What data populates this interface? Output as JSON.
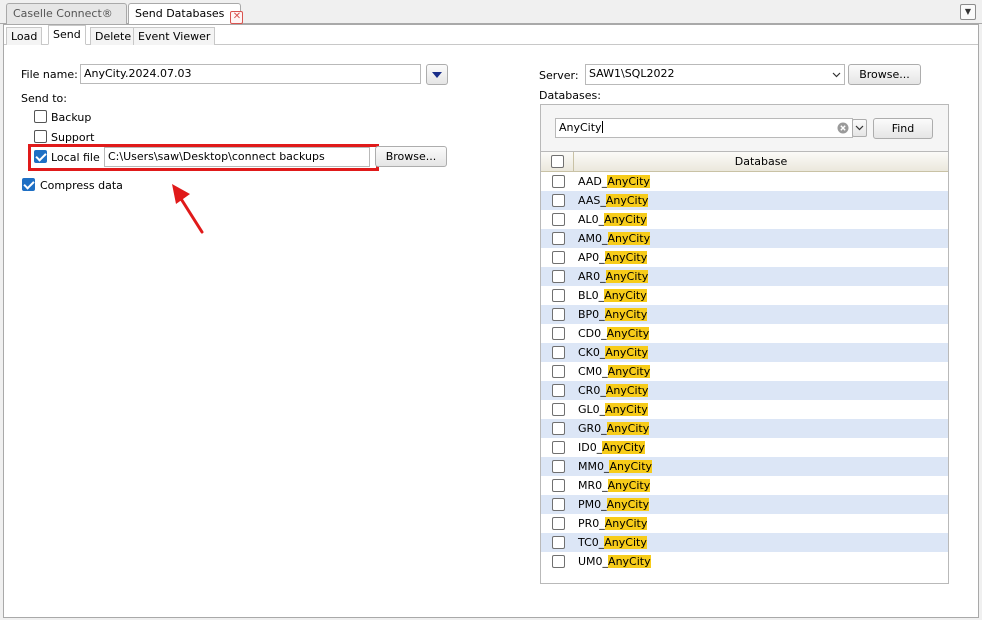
{
  "doc_tabs": {
    "tab1": "Caselle Connect®",
    "tab2": "Send Databases",
    "close_glyph": "✕",
    "menu_glyph": "▼"
  },
  "sub_tabs": [
    "Load",
    "Send",
    "Delete",
    "Event Viewer"
  ],
  "send": {
    "file_name_label": "File name:",
    "file_name_value": "AnyCity.2024.07.03",
    "send_to_label": "Send to:",
    "backup_label": "Backup",
    "support_label": "Support",
    "local_file_label": "Local file",
    "local_file_path": "C:\\Users\\saw\\Desktop\\connect backups",
    "browse_label": "Browse...",
    "compress_label": "Compress data"
  },
  "server": {
    "label": "Server:",
    "value": "SAW1\\SQL2022",
    "browse_label": "Browse...",
    "databases_label": "Databases:",
    "search_value": "AnyCity",
    "find_label": "Find",
    "column_header": "Database",
    "highlight_color": "#f7cc1a",
    "rows": [
      {
        "prefix": "AAD_",
        "match": "AnyCity"
      },
      {
        "prefix": "AAS_",
        "match": "AnyCity"
      },
      {
        "prefix": "AL0_",
        "match": "AnyCity"
      },
      {
        "prefix": "AM0_",
        "match": "AnyCity"
      },
      {
        "prefix": "AP0_",
        "match": "AnyCity"
      },
      {
        "prefix": "AR0_",
        "match": "AnyCity"
      },
      {
        "prefix": "BL0_",
        "match": "AnyCity"
      },
      {
        "prefix": "BP0_",
        "match": "AnyCity"
      },
      {
        "prefix": "CD0_",
        "match": "AnyCity"
      },
      {
        "prefix": "CK0_",
        "match": "AnyCity"
      },
      {
        "prefix": "CM0_",
        "match": "AnyCity"
      },
      {
        "prefix": "CR0_",
        "match": "AnyCity"
      },
      {
        "prefix": "GL0_",
        "match": "AnyCity"
      },
      {
        "prefix": "GR0_",
        "match": "AnyCity"
      },
      {
        "prefix": "ID0_",
        "match": "AnyCity"
      },
      {
        "prefix": "MM0_",
        "match": "AnyCity"
      },
      {
        "prefix": "MR0_",
        "match": "AnyCity"
      },
      {
        "prefix": "PM0_",
        "match": "AnyCity"
      },
      {
        "prefix": "PR0_",
        "match": "AnyCity"
      },
      {
        "prefix": "TC0_",
        "match": "AnyCity"
      },
      {
        "prefix": "UM0_",
        "match": "AnyCity"
      }
    ]
  },
  "annotation": {
    "color": "#e01a1a"
  }
}
